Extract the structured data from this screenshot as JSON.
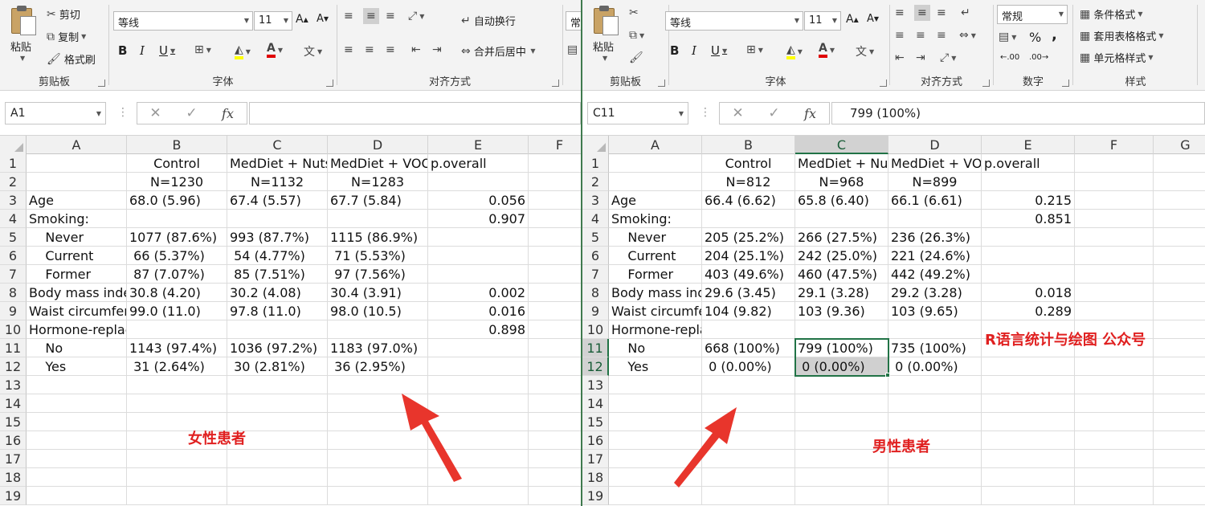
{
  "left": {
    "ribbon": {
      "clipboard": {
        "paste": "粘贴",
        "cut": "剪切",
        "copy": "复制",
        "format_painter": "格式刷",
        "label": "剪贴板"
      },
      "font": {
        "font_name": "等线",
        "font_size": "11",
        "bold": "B",
        "italic": "I",
        "underline": "U",
        "label": "字体"
      },
      "alignment": {
        "wrap_text": "自动换行",
        "merge_center": "合并后居中",
        "label": "对齐方式"
      },
      "number": {
        "format_partial": "常"
      }
    },
    "formula_bar": {
      "name_box": "A1",
      "fx": "fx",
      "formula": ""
    },
    "sheet": {
      "columns": [
        "A",
        "B",
        "C",
        "D",
        "E",
        "F"
      ],
      "rows": [
        "1",
        "2",
        "3",
        "4",
        "5",
        "6",
        "7",
        "8",
        "9",
        "10",
        "11",
        "12",
        "13",
        "14",
        "15",
        "16",
        "17",
        "18",
        "19"
      ],
      "cells": [
        [
          "",
          "Control",
          "MedDiet + Nuts",
          "MedDiet + VOO",
          "p.overall",
          ""
        ],
        [
          "",
          "N=1230",
          "N=1132",
          "N=1283",
          "",
          ""
        ],
        [
          "Age",
          "68.0 (5.96)",
          "67.4 (5.57)",
          "67.7 (5.84)",
          "0.056",
          ""
        ],
        [
          "Smoking:",
          "",
          "",
          "",
          "0.907",
          ""
        ],
        [
          "    Never",
          "1077 (87.6%)",
          "993 (87.7%)",
          "1115 (86.9%)",
          "",
          ""
        ],
        [
          "    Current",
          " 66 (5.37%)",
          " 54 (4.77%)",
          " 71 (5.53%)",
          "",
          ""
        ],
        [
          "    Former",
          " 87 (7.07%)",
          " 85 (7.51%)",
          " 97 (7.56%)",
          "",
          ""
        ],
        [
          "Body mass index",
          "30.8 (4.20)",
          "30.2 (4.08)",
          "30.4 (3.91)",
          "0.002",
          ""
        ],
        [
          "Waist circumference",
          "99.0 (11.0)",
          "97.8 (11.0)",
          "98.0 (10.5)",
          "0.016",
          ""
        ],
        [
          "Hormone-replacement",
          "",
          "",
          "",
          "0.898",
          ""
        ],
        [
          "    No",
          "1143 (97.4%)",
          "1036 (97.2%)",
          "1183 (97.0%)",
          "",
          ""
        ],
        [
          "    Yes",
          " 31 (2.64%)",
          " 30 (2.81%)",
          " 36 (2.95%)",
          "",
          ""
        ]
      ]
    },
    "annotation": "女性患者"
  },
  "right": {
    "ribbon": {
      "clipboard": {
        "paste": "粘贴",
        "label": "剪贴板"
      },
      "font": {
        "font_name": "等线",
        "font_size": "11",
        "bold": "B",
        "italic": "I",
        "underline": "U",
        "label": "字体"
      },
      "alignment": {
        "label": "对齐方式"
      },
      "number": {
        "format": "常规",
        "percent": "%",
        "comma": ",",
        "label": "数字"
      },
      "styles": {
        "conditional": "条件格式",
        "table": "套用表格格式",
        "cell_styles": "单元格样式",
        "label": "样式"
      }
    },
    "formula_bar": {
      "name_box": "C11",
      "fx": "fx",
      "formula": "799 (100%)"
    },
    "sheet": {
      "columns": [
        "A",
        "B",
        "C",
        "D",
        "E",
        "F",
        "G"
      ],
      "rows": [
        "1",
        "2",
        "3",
        "4",
        "5",
        "6",
        "7",
        "8",
        "9",
        "10",
        "11",
        "12",
        "13",
        "14",
        "15",
        "16",
        "17",
        "18",
        "19"
      ],
      "cells": [
        [
          "",
          "Control",
          "MedDiet + Nuts",
          "MedDiet + VOO",
          "p.overall",
          "",
          ""
        ],
        [
          "",
          "N=812",
          "N=968",
          "N=899",
          "",
          "",
          ""
        ],
        [
          "Age",
          "66.4 (6.62)",
          "65.8 (6.40)",
          "66.1 (6.61)",
          "0.215",
          "",
          ""
        ],
        [
          "Smoking:",
          "",
          "",
          "",
          "0.851",
          "",
          ""
        ],
        [
          "    Never",
          "205 (25.2%)",
          "266 (27.5%)",
          "236 (26.3%)",
          "",
          "",
          ""
        ],
        [
          "    Current",
          "204 (25.1%)",
          "242 (25.0%)",
          "221 (24.6%)",
          "",
          "",
          ""
        ],
        [
          "    Former",
          "403 (49.6%)",
          "460 (47.5%)",
          "442 (49.2%)",
          "",
          "",
          ""
        ],
        [
          "Body mass index",
          "29.6 (3.45)",
          "29.1 (3.28)",
          "29.2 (3.28)",
          "0.018",
          "",
          ""
        ],
        [
          "Waist circumference",
          "104 (9.82)",
          "103 (9.36)",
          "103 (9.65)",
          "0.289",
          "",
          ""
        ],
        [
          "Hormone-replacement",
          "",
          "",
          "",
          "",
          "",
          ""
        ],
        [
          "    No",
          "668 (100%)",
          "799 (100%)",
          "735 (100%)",
          "",
          "",
          ""
        ],
        [
          "    Yes",
          " 0 (0.00%)",
          " 0 (0.00%)",
          " 0 (0.00%)",
          "",
          "",
          ""
        ]
      ]
    },
    "annotation_title": "R语言统计与绘图 公众号",
    "annotation": "男性患者"
  },
  "colors": {
    "accent": "#217346",
    "annotation": "#e02020",
    "selection_gray": "#d0d0d0"
  }
}
